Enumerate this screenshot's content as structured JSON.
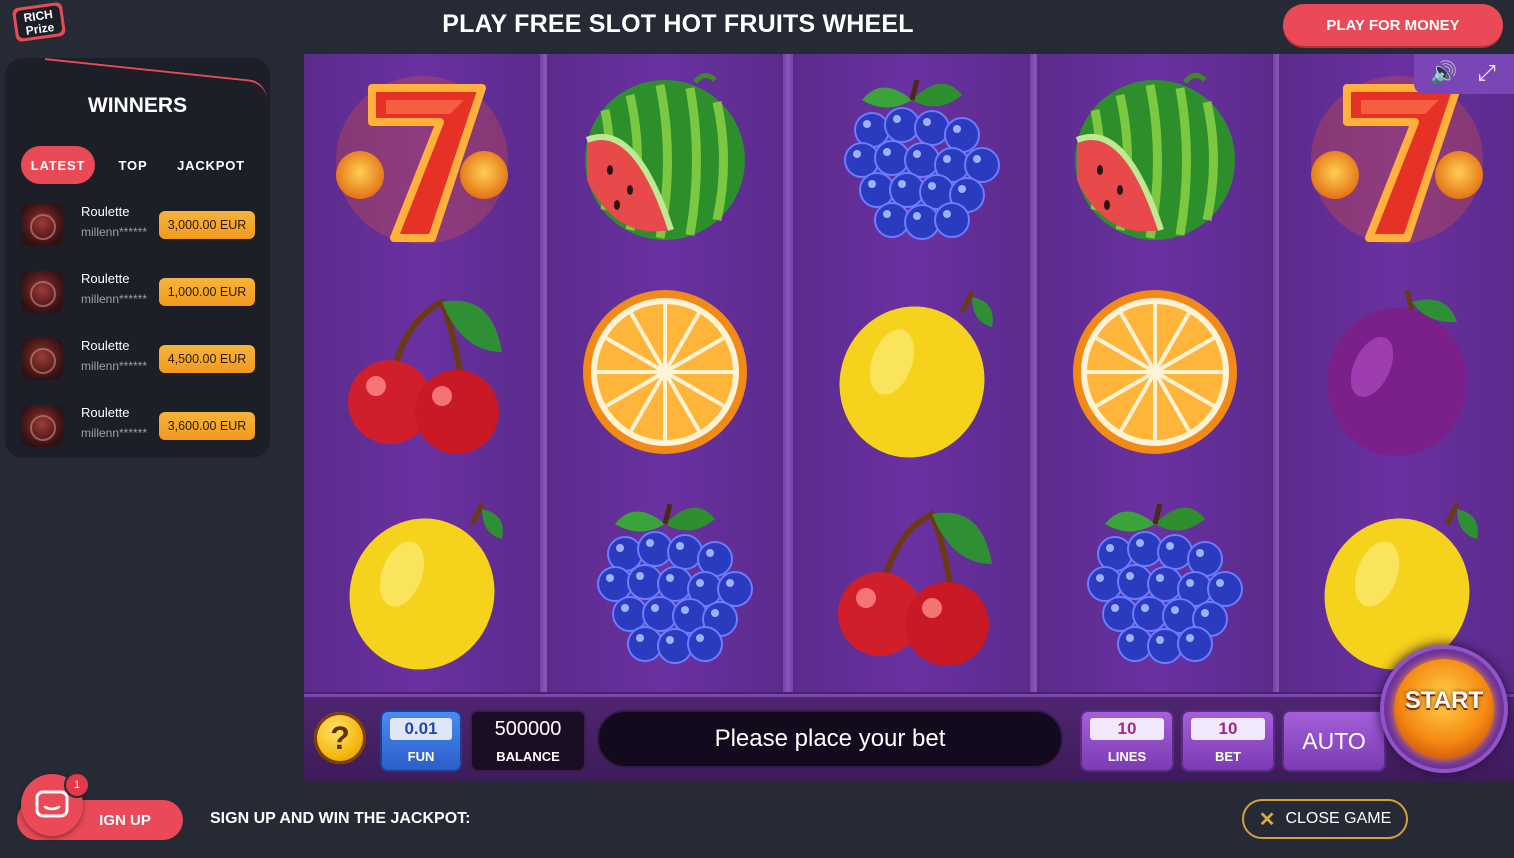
{
  "header": {
    "logo_text": "RICH Prize",
    "title": "PLAY FREE SLOT HOT FRUITS WHEEL",
    "play_for_money": "PLAY FOR MONEY"
  },
  "winners": {
    "title": "WINNERS",
    "tabs": [
      "LATEST",
      "TOP",
      "JACKPOT"
    ],
    "active_tab": "LATEST",
    "rows": [
      {
        "game": "Roulette",
        "user": "millenn******",
        "amount": "3,000.00 EUR"
      },
      {
        "game": "Roulette",
        "user": "millenn******",
        "amount": "1,000.00 EUR"
      },
      {
        "game": "Roulette",
        "user": "millenn******",
        "amount": "4,500.00 EUR"
      },
      {
        "game": "Roulette",
        "user": "millenn******",
        "amount": "3,600.00 EUR"
      }
    ]
  },
  "slot": {
    "reels": [
      [
        "seven",
        "cherry",
        "lemon"
      ],
      [
        "watermelon",
        "orange",
        "grapes"
      ],
      [
        "grapes",
        "lemon",
        "cherry"
      ],
      [
        "watermelon",
        "orange",
        "grapes"
      ],
      [
        "seven",
        "plum",
        "lemon"
      ]
    ],
    "controls": {
      "help": "?",
      "coin_value": "0.01",
      "coin_label": "FUN",
      "balance_value": "500000",
      "balance_label": "BALANCE",
      "message": "Please place your bet",
      "lines_value": "10",
      "lines_label": "LINES",
      "bet_value": "10",
      "bet_label": "BET",
      "auto": "AUTO",
      "start": "START"
    },
    "icons": [
      "sound-icon",
      "fullscreen-icon"
    ]
  },
  "footer": {
    "signup": "IGN UP",
    "chat_badge": "1",
    "jackpot_text": "SIGN UP AND WIN THE JACKPOT:",
    "close_game": "CLOSE GAME"
  },
  "colors": {
    "brand_red": "#ea4a57",
    "background": "#262a35",
    "reel_purple": "#5a2a88",
    "amount_orange": "#f29a1f"
  }
}
